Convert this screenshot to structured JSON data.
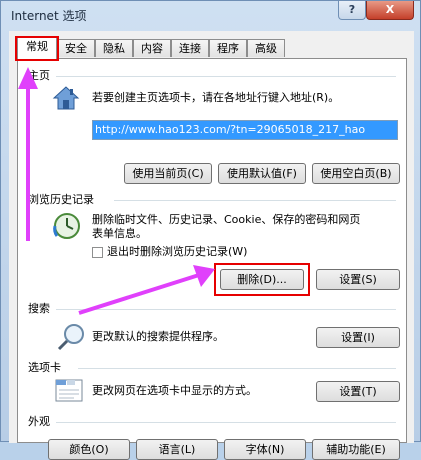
{
  "window": {
    "title": "Internet 选项",
    "help_glyph": "?",
    "close_glyph": "X"
  },
  "tabs": [
    "常规",
    "安全",
    "隐私",
    "内容",
    "连接",
    "程序",
    "高级"
  ],
  "homepage": {
    "label": "主页",
    "description": "若要创建主页选项卡，请在各地址行键入地址(R)。",
    "url": "http://www.hao123.com/?tn=29065018_217_hao",
    "buttons": [
      "使用当前页(C)",
      "使用默认值(F)",
      "使用空白页(B)"
    ]
  },
  "history": {
    "label": "浏览历史记录",
    "description": "删除临时文件、历史记录、Cookie、保存的密码和网页表单信息。",
    "checkbox_label": "退出时删除浏览历史记录(W)",
    "delete_button": "删除(D)...",
    "settings_button": "设置(S)"
  },
  "search": {
    "label": "搜索",
    "description": "更改默认的搜索提供程序。",
    "settings_button": "设置(I)"
  },
  "tabsgroup": {
    "label": "选项卡",
    "description": "更改网页在选项卡中显示的方式。",
    "settings_button": "设置(T)"
  },
  "appearance": {
    "label": "外观",
    "buttons": [
      "颜色(O)",
      "语言(L)",
      "字体(N)",
      "辅助功能(E)"
    ]
  },
  "colors": {
    "annotation": "#e60000",
    "arrow": "#e040fb",
    "selection": "#3399ff"
  }
}
